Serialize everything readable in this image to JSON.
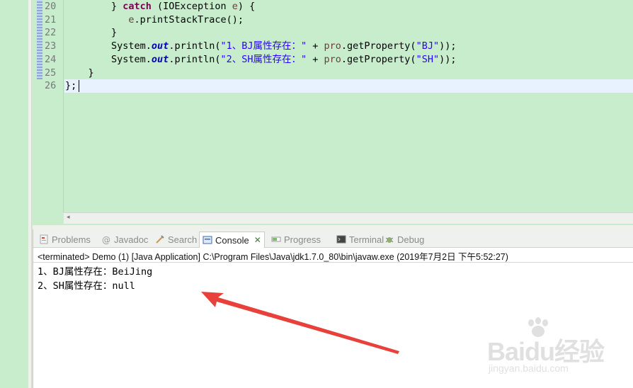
{
  "editor": {
    "lines": [
      {
        "no": "20",
        "tokens": [
          {
            "t": "        } "
          },
          {
            "t": "catch",
            "c": "kw"
          },
          {
            "t": " (IOException "
          },
          {
            "t": "e",
            "c": "var"
          },
          {
            "t": ") {"
          }
        ]
      },
      {
        "no": "21",
        "tokens": [
          {
            "t": "           "
          },
          {
            "t": "e",
            "c": "var"
          },
          {
            "t": ".printStackTrace();"
          }
        ]
      },
      {
        "no": "22",
        "tokens": [
          {
            "t": "        }"
          }
        ]
      },
      {
        "no": "23",
        "tokens": [
          {
            "t": "        System."
          },
          {
            "t": "out",
            "c": "fld"
          },
          {
            "t": ".println("
          },
          {
            "t": "\"1、BJ属性存在：\"",
            "c": "str"
          },
          {
            "t": " + "
          },
          {
            "t": "pro",
            "c": "var"
          },
          {
            "t": ".getProperty("
          },
          {
            "t": "\"BJ\"",
            "c": "str"
          },
          {
            "t": "));"
          }
        ]
      },
      {
        "no": "24",
        "tokens": [
          {
            "t": "        System."
          },
          {
            "t": "out",
            "c": "fld"
          },
          {
            "t": ".println("
          },
          {
            "t": "\"2、SH属性存在：\"",
            "c": "str"
          },
          {
            "t": " + "
          },
          {
            "t": "pro",
            "c": "var"
          },
          {
            "t": ".getProperty("
          },
          {
            "t": "\"SH\"",
            "c": "str"
          },
          {
            "t": "));"
          }
        ]
      },
      {
        "no": "25",
        "tokens": [
          {
            "t": "    }"
          }
        ]
      },
      {
        "no": "26",
        "tokens": [
          {
            "t": "};"
          }
        ]
      }
    ]
  },
  "tabs": [
    {
      "name": "tab-problems",
      "icon": "problems-icon",
      "label": "Problems",
      "active": false
    },
    {
      "name": "tab-javadoc",
      "icon": "javadoc-icon",
      "label": "Javadoc",
      "active": false
    },
    {
      "name": "tab-search",
      "icon": "search-icon",
      "label": "Search",
      "active": false
    },
    {
      "name": "tab-console",
      "icon": "console-icon",
      "label": "Console",
      "active": true
    },
    {
      "name": "tab-progress",
      "icon": "progress-icon",
      "label": "Progress",
      "active": false
    },
    {
      "name": "tab-terminal",
      "icon": "terminal-icon",
      "label": "Terminal",
      "active": false
    },
    {
      "name": "tab-debug",
      "icon": "debug-icon",
      "label": "Debug",
      "active": false
    }
  ],
  "console": {
    "status": "<terminated> Demo (1) [Java Application] C:\\Program Files\\Java\\jdk1.7.0_80\\bin\\javaw.exe (2019年7月2日 下午5:52:27)",
    "output": [
      "1、BJ属性存在：BeiJing",
      "2、SH属性存在：null"
    ]
  },
  "watermark": {
    "brand": "Baidu经验",
    "url": "jingyan.baidu.com"
  },
  "colors": {
    "editor_bg": "#c7edcc",
    "keyword": "#7f0055",
    "string": "#2a00ff",
    "arrow": "#e8403a"
  }
}
